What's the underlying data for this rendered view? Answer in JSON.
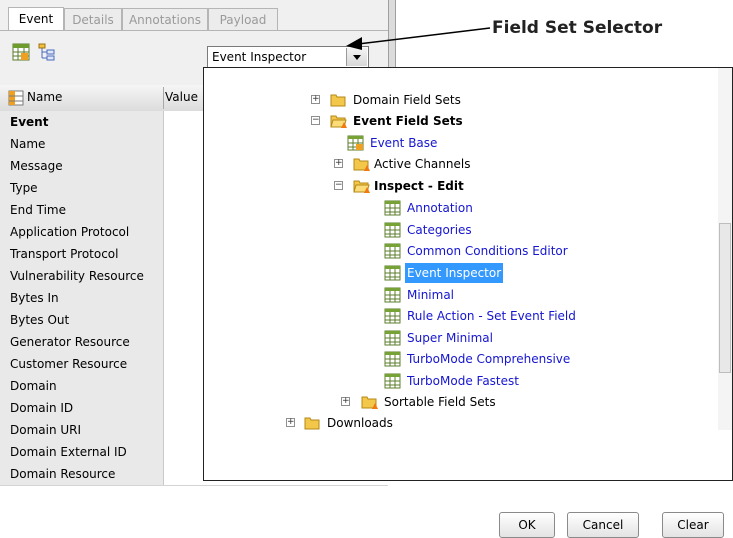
{
  "tabs": [
    {
      "label": "Event",
      "active": true
    },
    {
      "label": "Details",
      "active": false
    },
    {
      "label": "Annotations",
      "active": false
    },
    {
      "label": "Payload",
      "active": false
    }
  ],
  "toolbar": {
    "grid_icon": "table-view-icon",
    "tree_icon": "tree-view-icon"
  },
  "field_set_select": {
    "value": "Event Inspector"
  },
  "annotation": {
    "label": "Field Set Selector"
  },
  "grid": {
    "header_name": "Name",
    "header_value": "Value",
    "rows": [
      "Event",
      "Name",
      "Message",
      "Type",
      "End Time",
      "Application Protocol",
      "Transport Protocol",
      "Vulnerability Resource",
      "Bytes In",
      "Bytes Out",
      "Generator Resource",
      "Customer Resource",
      "Domain",
      "Domain ID",
      "Domain URI",
      "Domain External ID",
      "Domain Resource"
    ]
  },
  "tree": [
    {
      "label": "Domain Field Sets",
      "kind": "folder",
      "expander": "+"
    },
    {
      "label": "Event Field Sets",
      "kind": "folder-open-locked",
      "expander": "−"
    },
    {
      "label": "Event Base",
      "kind": "fieldset"
    },
    {
      "label": "Active Channels",
      "kind": "folder-locked",
      "expander": "+"
    },
    {
      "label": "Inspect - Edit",
      "kind": "folder-open-locked",
      "expander": "−"
    },
    {
      "label": "Annotation",
      "kind": "table"
    },
    {
      "label": "Categories",
      "kind": "table"
    },
    {
      "label": "Common Conditions Editor",
      "kind": "table"
    },
    {
      "label": "Event Inspector",
      "kind": "table",
      "selected": true
    },
    {
      "label": "Minimal",
      "kind": "table"
    },
    {
      "label": "Rule Action - Set Event Field",
      "kind": "table"
    },
    {
      "label": "Super Minimal",
      "kind": "table"
    },
    {
      "label": "TurboMode Comprehensive",
      "kind": "table"
    },
    {
      "label": "TurboMode Fastest",
      "kind": "table"
    },
    {
      "label": "Sortable Field Sets",
      "kind": "folder-locked",
      "expander": "+"
    },
    {
      "label": "Downloads",
      "kind": "folder",
      "expander": "+"
    }
  ],
  "buttons": {
    "ok": "OK",
    "cancel": "Cancel",
    "clear": "Clear"
  },
  "colors": {
    "link": "#1515d0",
    "selection": "#3399ff",
    "folder": "#f3c74a"
  }
}
